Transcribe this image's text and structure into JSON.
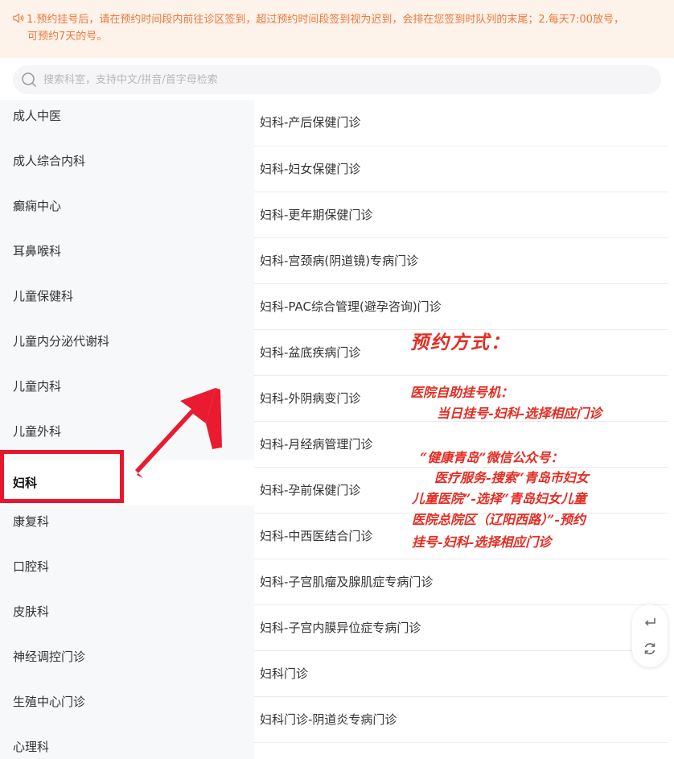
{
  "notice": {
    "icon": "speaker-icon",
    "line1": "1.预约挂号后，请在预约时间段内前往诊区签到，超过预约时间段签到视为迟到，会排在您签到时队列的末尾；2.每天7:00放号，",
    "line2": "可预约7天的号。"
  },
  "search": {
    "icon": "search-icon",
    "placeholder": "搜索科室，支持中文/拼音/首字母检索"
  },
  "sidebar": {
    "items": [
      {
        "label": "成人中医"
      },
      {
        "label": "成人综合内科"
      },
      {
        "label": "癫痫中心"
      },
      {
        "label": "耳鼻喉科"
      },
      {
        "label": "儿童保健科"
      },
      {
        "label": "儿童内分泌代谢科"
      },
      {
        "label": "儿童内科"
      },
      {
        "label": "儿童外科"
      },
      {
        "label": "妇科"
      },
      {
        "label": "康复科"
      },
      {
        "label": "口腔科"
      },
      {
        "label": "皮肤科"
      },
      {
        "label": "神经调控门诊"
      },
      {
        "label": "生殖中心门诊"
      },
      {
        "label": "心理科"
      }
    ],
    "active_index": 8
  },
  "departments": [
    {
      "label": "妇科-产后保健门诊"
    },
    {
      "label": "妇科-妇女保健门诊"
    },
    {
      "label": "妇科-更年期保健门诊"
    },
    {
      "label": "妇科-宫颈病(阴道镜)专病门诊"
    },
    {
      "label": "妇科-PAC综合管理(避孕咨询)门诊"
    },
    {
      "label": "妇科-盆底疾病门诊"
    },
    {
      "label": "妇科-外阴病变门诊"
    },
    {
      "label": "妇科-月经病管理门诊"
    },
    {
      "label": "妇科-孕前保健门诊"
    },
    {
      "label": "妇科-中西医结合门诊"
    },
    {
      "label": "妇科-子宫肌瘤及腺肌症专病门诊"
    },
    {
      "label": "妇科-子宫内膜异位症专病门诊"
    },
    {
      "label": "妇科门诊"
    },
    {
      "label": "妇科门诊-阴道炎专病门诊"
    }
  ],
  "annotation": {
    "title": "预约方式：",
    "l1": "医院自助挂号机：",
    "l2": "当日挂号-妇科-选择相应门诊",
    "l3": "“健康青岛”微信公众号：",
    "l4": "医疗服务-搜索“青岛市妇女",
    "l5": "儿童医院”-选择“青岛妇女儿童",
    "l6": "医院总院区（辽阳西路）”-预约",
    "l7": "挂号-妇科-选择相应门诊",
    "color": "#e52c22"
  },
  "tools": {
    "back_icon": "return-icon",
    "refresh_icon": "refresh-icon"
  },
  "colors": {
    "accent": "#f0763a",
    "highlight": "#e8172d"
  }
}
